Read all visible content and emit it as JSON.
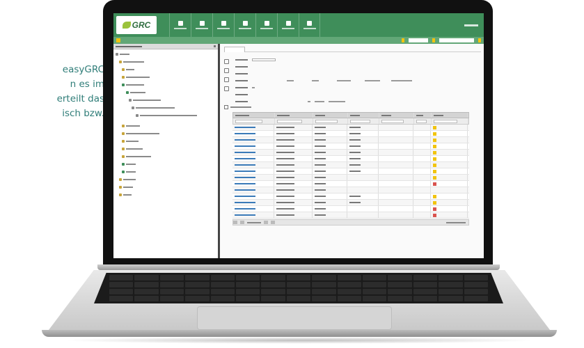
{
  "side_text": {
    "lines": [
      "easyGRC",
      "n es im",
      "erteilt das",
      "isch bzw."
    ]
  },
  "app": {
    "logo": "GRC",
    "nav_items": [
      "home-icon",
      "user-icon",
      "grid-icon",
      "person-icon",
      "chart-icon",
      "lock-icon",
      "dashboard-icon"
    ]
  },
  "colors": {
    "accent_green": "#3f8e5a",
    "side_text_teal": "#2f7d78",
    "flag_yellow": "#f1c40f",
    "flag_red": "#d9534f"
  }
}
